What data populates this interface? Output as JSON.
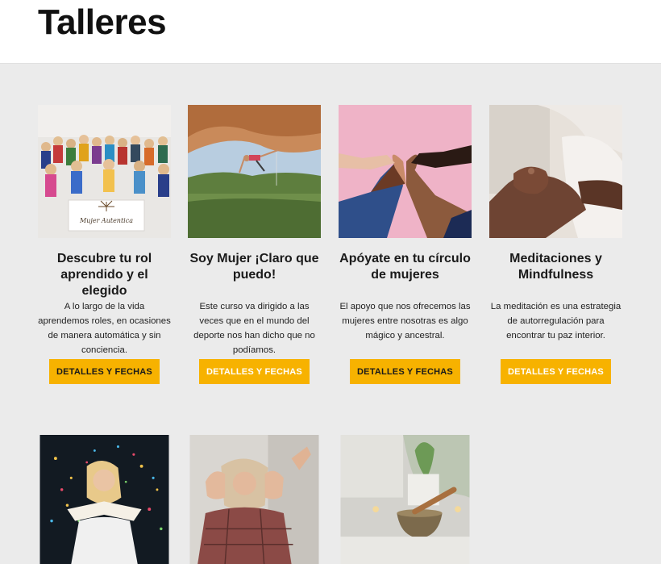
{
  "header": {
    "title": "Talleres"
  },
  "colors": {
    "accent": "#f7b200",
    "background": "#ebebeb"
  },
  "cards": [
    {
      "title": "Descubre tu rol aprendido y el elegido",
      "description": "A lo largo de la vida aprendemos roles, en ocasiones de manera automática y sin conciencia.",
      "button": "DETALLES Y FECHAS",
      "image_caption": "Mujer Autentica"
    },
    {
      "title": "Soy Mujer ¡Claro que puedo!",
      "description": "Este curso va dirigido a las veces que en el mundo del deporte nos han dicho que no podíamos.",
      "button": "DETALLES Y FECHAS"
    },
    {
      "title": "Apóyate en tu círculo de mujeres",
      "description": "El apoyo que nos ofrecemos las mujeres entre nosotras es algo mágico y ancestral.",
      "button": "DETALLES Y FECHAS"
    },
    {
      "title": "Meditaciones y Mindfulness",
      "description": "La meditación es una estrategia de autorregulación para encontrar tu paz interior.",
      "button": "DETALLES Y FECHAS"
    },
    {},
    {},
    {}
  ]
}
